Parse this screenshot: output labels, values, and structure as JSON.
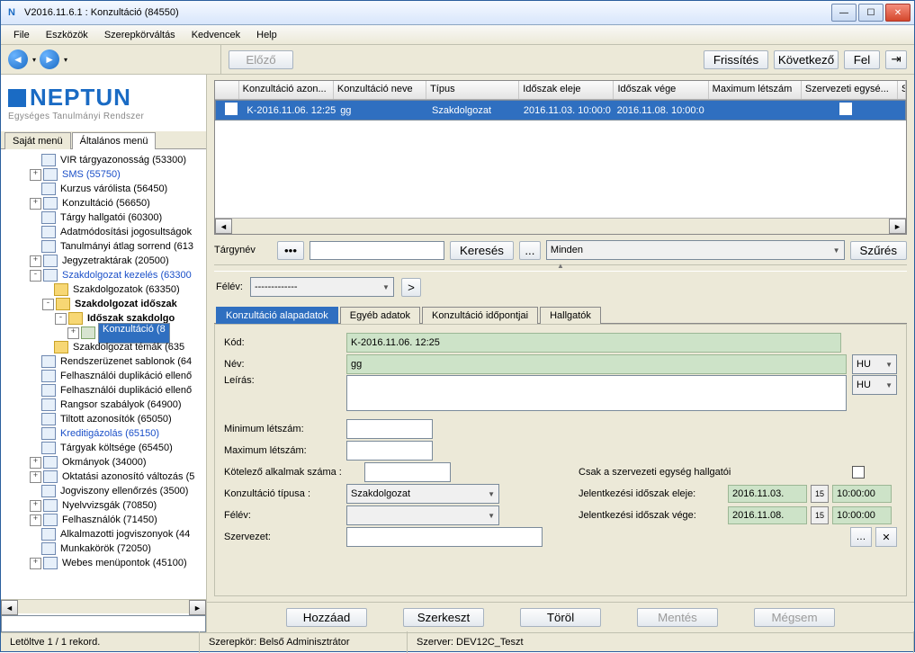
{
  "window": {
    "title": "V2016.11.6.1 : Konzultáció (84550)"
  },
  "menubar": [
    "File",
    "Eszközök",
    "Szerepkörváltás",
    "Kedvencek",
    "Help"
  ],
  "logo": {
    "main": "NEPTUN",
    "sub": "Egységes Tanulmányi Rendszer"
  },
  "left_tabs": {
    "t1": "Saját menü",
    "t2": "Általános menü"
  },
  "tree": [
    {
      "d": 2,
      "pm": "",
      "ico": "doc",
      "lbl": "VIR tárgyazonosság (53300)"
    },
    {
      "d": 2,
      "pm": "+",
      "ico": "doc",
      "lbl": "SMS (55750)",
      "blue": true
    },
    {
      "d": 2,
      "pm": "",
      "ico": "doc",
      "lbl": "Kurzus várólista (56450)"
    },
    {
      "d": 2,
      "pm": "+",
      "ico": "doc",
      "lbl": "Konzultáció (56650)"
    },
    {
      "d": 2,
      "pm": "",
      "ico": "doc",
      "lbl": "Tárgy hallgatói (60300)"
    },
    {
      "d": 2,
      "pm": "",
      "ico": "doc",
      "lbl": "Adatmódosítási jogosultságok"
    },
    {
      "d": 2,
      "pm": "",
      "ico": "doc",
      "lbl": "Tanulmányi átlag sorrend (613"
    },
    {
      "d": 2,
      "pm": "+",
      "ico": "doc",
      "lbl": "Jegyzetraktárak (20500)"
    },
    {
      "d": 2,
      "pm": "-",
      "ico": "doc",
      "lbl": "Szakdolgozat kezelés (63300",
      "blue": true
    },
    {
      "d": 3,
      "pm": "",
      "ico": "fold",
      "lbl": "Szakdolgozatok (63350)"
    },
    {
      "d": 3,
      "pm": "-",
      "ico": "fold",
      "lbl": "Szakdolgozat időszak",
      "bold": true
    },
    {
      "d": 4,
      "pm": "-",
      "ico": "fold",
      "lbl": "Időszak szakdolgo",
      "bold": true
    },
    {
      "d": 5,
      "pm": "+",
      "ico": "gear",
      "lbl": "Konzultáció (8",
      "sel": true
    },
    {
      "d": 3,
      "pm": "",
      "ico": "fold",
      "lbl": "Szakdolgozat témák (635"
    },
    {
      "d": 2,
      "pm": "",
      "ico": "doc",
      "lbl": "Rendszerüzenet sablonok (64"
    },
    {
      "d": 2,
      "pm": "",
      "ico": "doc",
      "lbl": "Felhasználói duplikáció ellenő"
    },
    {
      "d": 2,
      "pm": "",
      "ico": "doc",
      "lbl": "Felhasználói duplikáció ellenő"
    },
    {
      "d": 2,
      "pm": "",
      "ico": "doc",
      "lbl": "Rangsor szabályok (64900)"
    },
    {
      "d": 2,
      "pm": "",
      "ico": "doc",
      "lbl": "Tiltott azonosítók (65050)"
    },
    {
      "d": 2,
      "pm": "",
      "ico": "doc",
      "lbl": "Kreditigázolás (65150)",
      "blue": true
    },
    {
      "d": 2,
      "pm": "",
      "ico": "doc",
      "lbl": "Tárgyak költsége (65450)"
    },
    {
      "d": 2,
      "pm": "+",
      "ico": "doc",
      "lbl": "Okmányok (34000)"
    },
    {
      "d": 2,
      "pm": "+",
      "ico": "doc",
      "lbl": "Oktatási azonosító változás (5"
    },
    {
      "d": 2,
      "pm": "",
      "ico": "doc",
      "lbl": "Jogviszony ellenőrzés (3500)"
    },
    {
      "d": 2,
      "pm": "+",
      "ico": "doc",
      "lbl": "Nyelvvizsgák (70850)"
    },
    {
      "d": 2,
      "pm": "+",
      "ico": "doc",
      "lbl": "Felhasználók (71450)"
    },
    {
      "d": 2,
      "pm": "",
      "ico": "doc",
      "lbl": "Alkalmazotti jogviszonyok (44"
    },
    {
      "d": 2,
      "pm": "",
      "ico": "doc",
      "lbl": "Munkakörök (72050)"
    },
    {
      "d": 2,
      "pm": "+",
      "ico": "doc",
      "lbl": "Webes menüpontok (45100)"
    }
  ],
  "top_buttons": {
    "prev": "Előző",
    "refresh": "Frissítés",
    "next": "Következő",
    "up": "Fel"
  },
  "grid": {
    "headers": [
      "",
      "Konzultáció azon...",
      "Konzultáció neve",
      "Típus",
      "Időszak eleje",
      "Időszak vége",
      "Maximum létszám",
      "Szervezeti egysé...",
      "Sz"
    ],
    "row": {
      "azon": "K-2016.11.06. 12:25",
      "neve": "gg",
      "tipus": "Szakdolgozat",
      "eleje": "2016.11.03. 10:00:0",
      "vege": "2016.11.08. 10:00:0",
      "max": "",
      "szerv_cb": ""
    }
  },
  "search": {
    "lbl": "Tárgynév",
    "btn": "Keresés",
    "ellips": "...",
    "filter_sel": "Minden",
    "filter_btn": "Szűrés"
  },
  "semester": {
    "lbl": "Félév:",
    "val": "-------------",
    "go": ">"
  },
  "tabs": {
    "t1": "Konzultáció alapadatok",
    "t2": "Egyéb adatok",
    "t3": "Konzultáció időpontjai",
    "t4": "Hallgatók"
  },
  "form": {
    "kod_lbl": "Kód:",
    "kod_val": "K-2016.11.06. 12:25",
    "nev_lbl": "Név:",
    "nev_val": "gg",
    "leiras_lbl": "Leírás:",
    "lang": "HU",
    "min_lbl": "Minimum létszám:",
    "max_lbl": "Maximum létszám:",
    "kot_lbl": "Kötelező alkalmak száma :",
    "tipus_lbl": "Konzultáció típusa :",
    "tipus_val": "Szakdolgozat",
    "felev_lbl": "Félév:",
    "szerv_lbl": "Szervezet:",
    "csak_lbl": "Csak a szervezeti egység hallgatói",
    "jel_eleje_lbl": "Jelentkezési időszak eleje:",
    "jel_vege_lbl": "Jelentkezési időszak vége:",
    "d1": "2016.11.03.",
    "t1": "10:00:00",
    "d2": "2016.11.08.",
    "t2": "10:00:00"
  },
  "bottom": {
    "add": "Hozzáad",
    "edit": "Szerkeszt",
    "del": "Töröl",
    "save": "Mentés",
    "cancel": "Mégsem"
  },
  "status": {
    "s1": "Letöltve 1 / 1 rekord.",
    "s2": "Szerepkör: Belső Adminisztrátor",
    "s3": "Szerver: DEV12C_Teszt"
  }
}
